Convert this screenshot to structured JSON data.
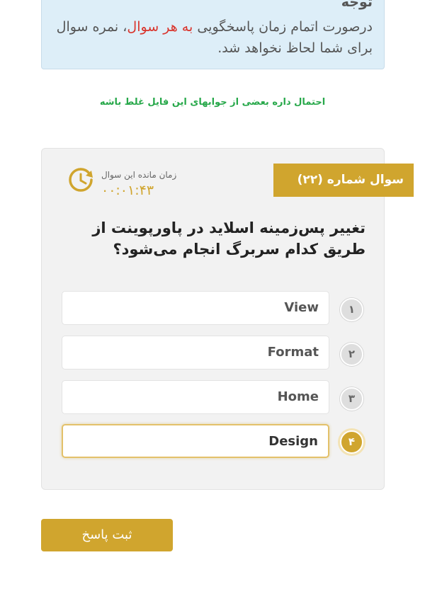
{
  "notice": {
    "title": "توجه",
    "text_before": "درصورت اتمام زمان پاسخگویی ",
    "text_emphasis": "به هر سوال",
    "text_after": "، نمره سوال برای شما لحاظ نخواهد شد."
  },
  "warning": "احتمال داره بعضی از جوابهای این فایل غلط باشه",
  "question": {
    "badge": "سوال شماره (۲۲)",
    "timer_label": "زمان مانده این سوال",
    "timer_value": "۰۰:۰۱:۴۳",
    "text": "تغییر پس‌زمینه اسلاید در پاورپوینت از طریق کدام سربرگ انجام می‌شود؟",
    "options": [
      {
        "number": "۱",
        "label": "View",
        "selected": false
      },
      {
        "number": "۲",
        "label": "Format",
        "selected": false
      },
      {
        "number": "۳",
        "label": "Home",
        "selected": false
      },
      {
        "number": "۴",
        "label": "Design",
        "selected": true
      }
    ]
  },
  "submit_label": "ثبت پاسخ",
  "colors": {
    "accent": "#d0a52e",
    "notice_bg": "#ddeef8",
    "warning": "#27a84a",
    "emphasis": "#d9332b"
  }
}
